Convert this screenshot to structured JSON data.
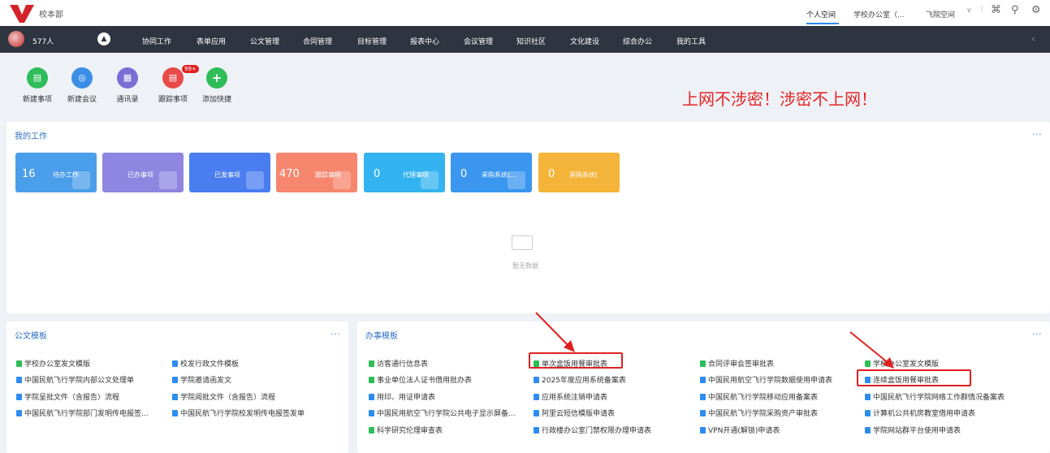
{
  "header": {
    "org_name": "校本部",
    "tabs": [
      "个人空间",
      "学校办公室（...",
      "飞院空间"
    ]
  },
  "nav": {
    "user_count": "577人",
    "menu": [
      "协同工作",
      "表单应用",
      "公文管理",
      "合同管理",
      "目标管理",
      "报表中心",
      "会议管理",
      "知识社区",
      "文化建设",
      "综合办公",
      "我的工具"
    ]
  },
  "quick_actions": [
    {
      "label": "新建事项",
      "color": "#2ebd59"
    },
    {
      "label": "新建会议",
      "color": "#3a8ee6"
    },
    {
      "label": "通讯录",
      "color": "#7b6fd6"
    },
    {
      "label": "跟踪事项",
      "color": "#e84a4a"
    },
    {
      "label": "添加快捷",
      "color": "#2ebd59"
    }
  ],
  "badge": "99+",
  "slogan": "上网不涉密！涉密不上网！",
  "my_work": {
    "title": "我的工作",
    "more": "...",
    "cards": [
      {
        "count": "16",
        "label": "待办工作",
        "color": "#4b9eea"
      },
      {
        "count": "",
        "label": "已办事项",
        "color": "#8e86e0"
      },
      {
        "count": "",
        "label": "已发事项",
        "color": "#4a7ef0"
      },
      {
        "count": "470",
        "label": "跟踪事项",
        "color": "#f7866e"
      },
      {
        "count": "0",
        "label": "代理事项",
        "color": "#33b3f0"
      },
      {
        "count": "0",
        "label": "采购系统(...",
        "color": "#3a96ef"
      },
      {
        "count": "0",
        "label": "采购系统(",
        "color": "#f4b43a"
      }
    ],
    "empty_text": "暂无数据"
  },
  "doc_templates": {
    "title": "公文模板",
    "more": "...",
    "col1": [
      "学校办公室发文模版",
      "中国民航飞行学院内部公文处理单",
      "学院呈批文件（含报告）流程",
      "中国民航飞行学院部门发明传电报签..."
    ],
    "col2": [
      "校发行政文件模板",
      "学院邀请函发文",
      "学院阅批文件（含报告）流程",
      "中国民航飞行学院校发明传电报签发单"
    ]
  },
  "work_templates": {
    "title": "办事模板",
    "more": "...",
    "col1": [
      "访客通行信息表",
      "事业单位法人证书借用批办表",
      "用印、用证申请表",
      "中国民用航空飞行学院公共电子显示屏备...",
      "科学研究伦理审查表"
    ],
    "col2": [
      "单次盒饭用餐审批表",
      "2025年度应用系统备案表",
      "应用系统注销申请表",
      "阿里云短信模版申请表",
      "行政楼办公室门禁权限办理申请表"
    ],
    "col3": [
      "合同评审会签审批表",
      "中国民用航空飞行学院数据使用申请表",
      "中国民航飞行学院移动应用备案表",
      "中国民航飞行学院采购资产审批表",
      "VPN开通(解锁)申请表"
    ],
    "col4": [
      "学校办公室发文模版",
      "连续盒饭用餐审批表",
      "中国民航飞行学院网络工作群情况备案表",
      "计算机公共机房教室借用申请表",
      "学院网站群平台使用申请表"
    ]
  }
}
